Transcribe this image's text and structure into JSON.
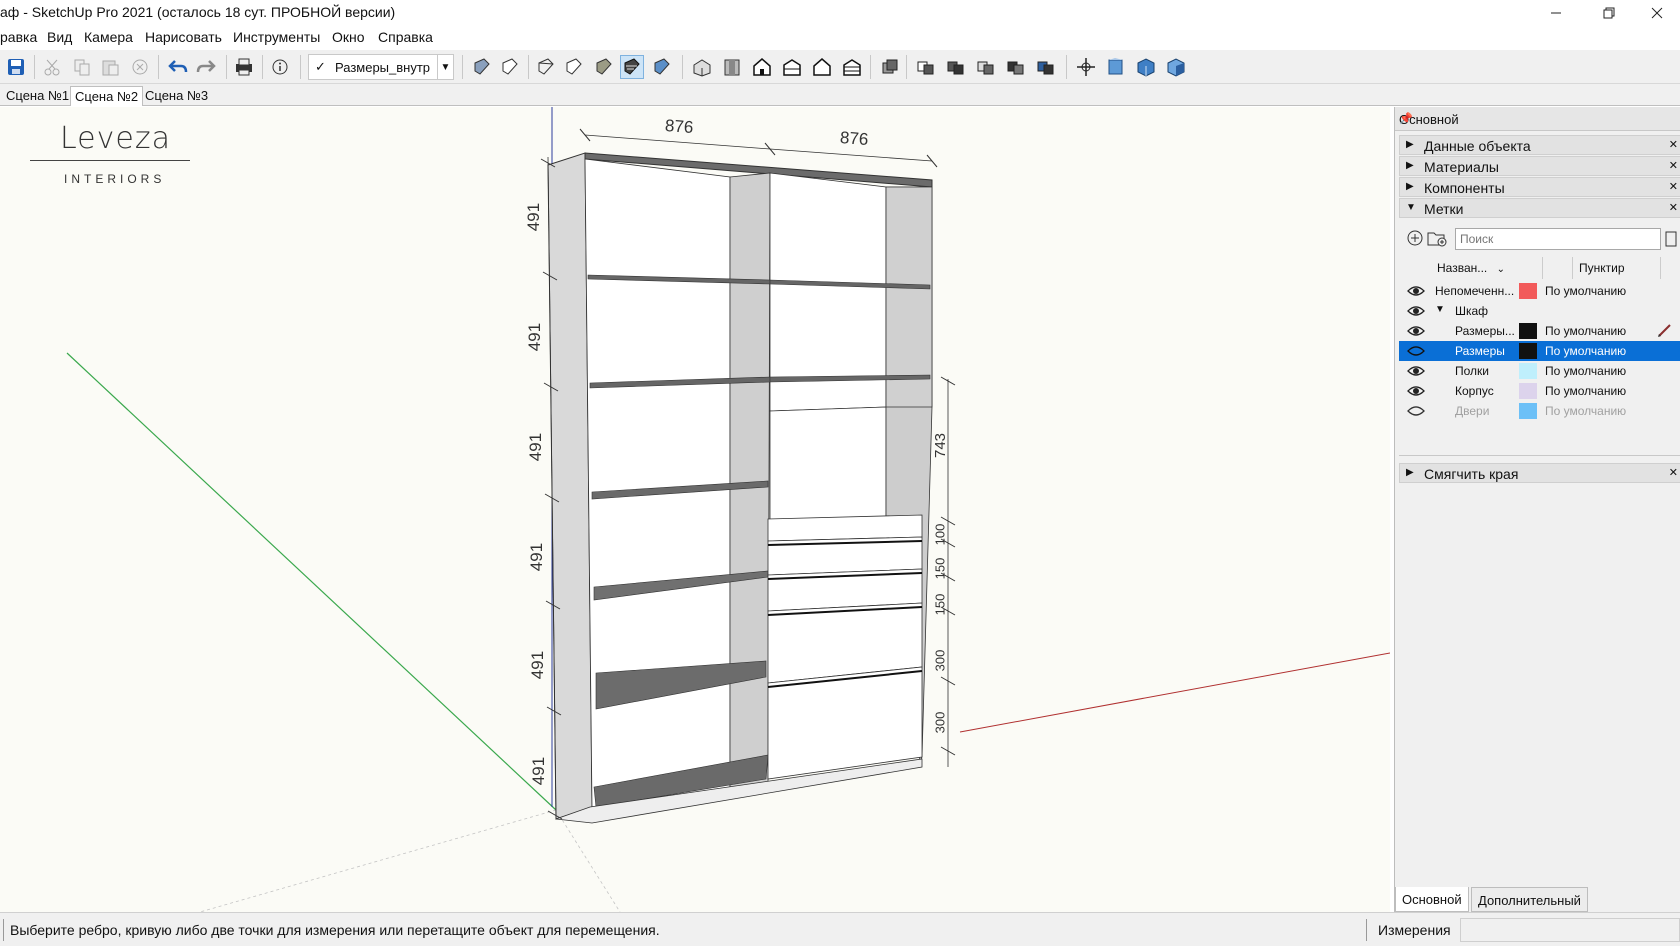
{
  "window": {
    "title": "аф - SketchUp Pro 2021 (осталось 18 сут. ПРОБНОЙ версии)",
    "minimize_icon": "minimize-icon",
    "restore_icon": "restore-icon",
    "close_icon": "close-icon"
  },
  "menu": [
    "равка",
    "Вид",
    "Камера",
    "Нарисовать",
    "Инструменты",
    "Окно",
    "Справка"
  ],
  "toolbar": {
    "scene_selector": "Размеры_внутр",
    "icons": [
      "save-icon",
      "cut-icon",
      "copy-icon",
      "paste-icon",
      "erase-icon",
      "undo-icon",
      "redo-icon",
      "print-icon",
      "model-info-icon"
    ]
  },
  "scene_tabs": [
    "Сцена №1",
    "Сцена №2",
    "Сцена №3"
  ],
  "active_scene": "Сцена №2",
  "viewport": {
    "logo_main": "Leveza",
    "logo_sub": "INTERIORS",
    "dimensions": {
      "width_left": "876",
      "width_right": "876",
      "left_heights": [
        "491",
        "491",
        "491",
        "491",
        "491",
        "491"
      ],
      "right_top": "743",
      "drawers": [
        "100",
        "150",
        "150",
        "300",
        "300"
      ]
    }
  },
  "panel": {
    "header": "Основной",
    "sections": [
      {
        "label": "Данные объекта",
        "expanded": false
      },
      {
        "label": "Материалы",
        "expanded": false
      },
      {
        "label": "Компоненты",
        "expanded": false
      },
      {
        "label": "Метки",
        "expanded": true
      }
    ],
    "search_placeholder": "Поиск",
    "col_name": "Назван...",
    "col_dash": "Пунктир",
    "tags": [
      {
        "name": "Непомеченн...",
        "color": "#f25a5a",
        "dash": "По умолчанию",
        "visible": true,
        "selected": false,
        "indent": 0
      },
      {
        "name": "Шкаф",
        "color": "",
        "dash": "",
        "visible": true,
        "selected": false,
        "indent": 1
      },
      {
        "name": "Размеры...",
        "color": "#111111",
        "dash": "По умолчанию",
        "visible": true,
        "selected": false,
        "indent": 2
      },
      {
        "name": "Размеры",
        "color": "#111111",
        "dash": "По умолчанию",
        "visible": false,
        "selected": true,
        "indent": 2
      },
      {
        "name": "Полки",
        "color": "#bfeffc",
        "dash": "По умолчанию",
        "visible": true,
        "selected": false,
        "indent": 2
      },
      {
        "name": "Корпус",
        "color": "#dcd3ec",
        "dash": "По умолчанию",
        "visible": true,
        "selected": false,
        "indent": 2
      },
      {
        "name": "Двери",
        "color": "#6cc0f7",
        "dash": "По умолчанию",
        "visible": false,
        "selected": false,
        "indent": 2
      }
    ],
    "soften_label": "Смягчить края",
    "bottom_tabs": [
      "Основной",
      "Дополнительный"
    ]
  },
  "status": {
    "message": "Выберите ребро, кривую либо две точки для измерения или перетащите объект для перемещения.",
    "measure_label": "Измерения"
  }
}
